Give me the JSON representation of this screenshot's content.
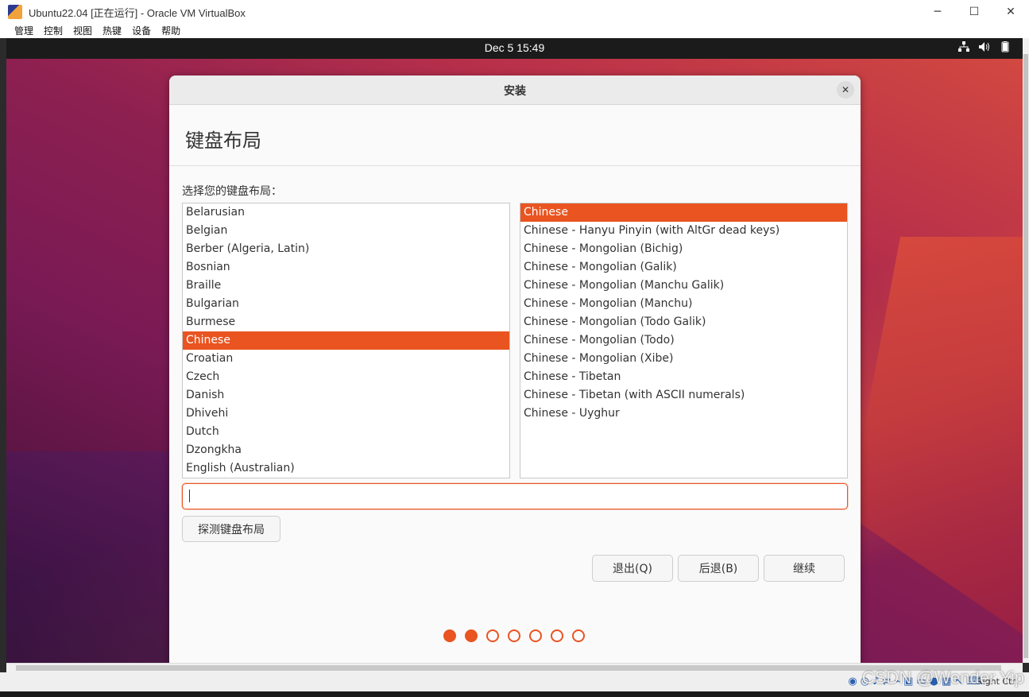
{
  "host": {
    "window_title": "Ubuntu22.04 [正在运行] - Oracle VM VirtualBox",
    "menu": [
      "管理",
      "控制",
      "视图",
      "热键",
      "设备",
      "帮助"
    ],
    "minimize": "─",
    "maximize": "☐",
    "close": "✕",
    "host_key": "Right Ctrl",
    "watermark": "CSDN @Wender Yip"
  },
  "guest_topbar": {
    "clock": "Dec 5  15:49",
    "tray_icons": [
      "network-icon",
      "volume-icon",
      "battery-icon"
    ]
  },
  "dialog": {
    "title": "安装",
    "heading": "键盘布局",
    "prompt": "选择您的键盘布局：",
    "layouts": [
      "Belarusian",
      "Belgian",
      "Berber (Algeria, Latin)",
      "Bosnian",
      "Braille",
      "Bulgarian",
      "Burmese",
      "Chinese",
      "Croatian",
      "Czech",
      "Danish",
      "Dhivehi",
      "Dutch",
      "Dzongkha",
      "English (Australian)"
    ],
    "selected_layout": "Chinese",
    "variants": [
      "Chinese",
      "Chinese - Hanyu Pinyin (with AltGr dead keys)",
      "Chinese - Mongolian (Bichig)",
      "Chinese - Mongolian (Galik)",
      "Chinese - Mongolian (Manchu Galik)",
      "Chinese - Mongolian (Manchu)",
      "Chinese - Mongolian (Todo Galik)",
      "Chinese - Mongolian (Todo)",
      "Chinese - Mongolian (Xibe)",
      "Chinese - Tibetan",
      "Chinese - Tibetan (with ASCII numerals)",
      "Chinese - Uyghur"
    ],
    "selected_variant": "Chinese",
    "test_input_value": "",
    "detect_button": "探测键盘布局",
    "quit_button": "退出(Q)",
    "back_button": "后退(B)",
    "continue_button": "继续",
    "progress": {
      "total_steps": 7,
      "completed_steps": 2
    },
    "accent_color": "#e95420"
  }
}
